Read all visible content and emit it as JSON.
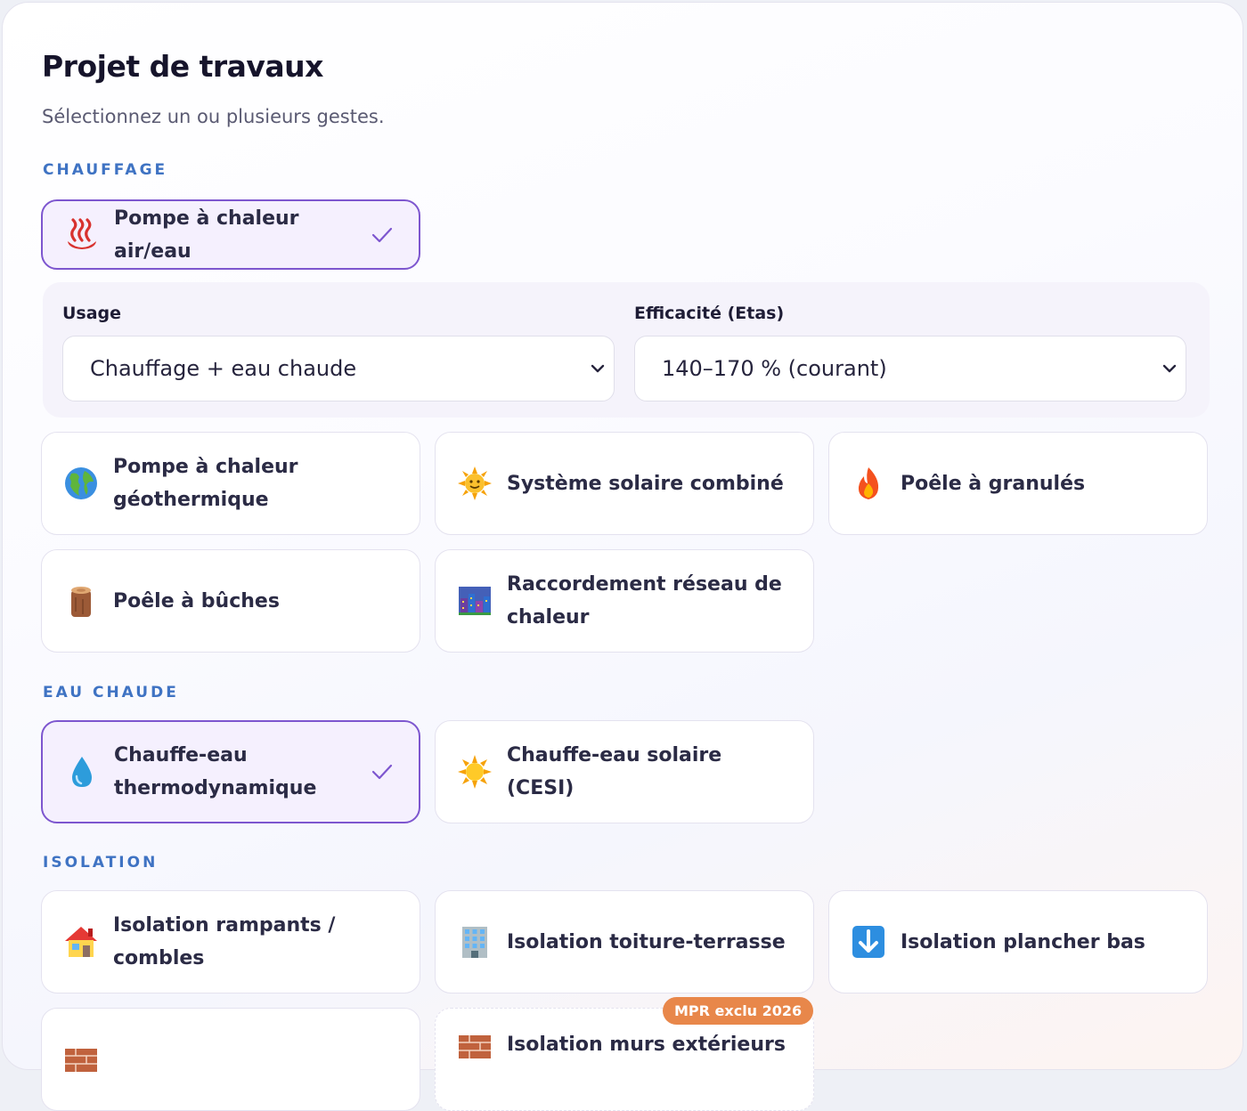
{
  "title": "Projet de travaux",
  "subtitle": "Sélectionnez un ou plusieurs gestes.",
  "accent_color": "#7d56cf",
  "section_color": "#3f73c3",
  "sections": {
    "chauffage": {
      "label": "CHAUFFAGE",
      "selected": {
        "label": "Pompe à chaleur air/eau",
        "icon": "hot-springs-icon",
        "selected": true
      },
      "config": {
        "usage": {
          "label": "Usage",
          "value": "Chauffage + eau chaude"
        },
        "efficacite": {
          "label": "Efficacité (Etas)",
          "value": "140–170 % (courant)"
        }
      },
      "items": [
        {
          "label": "Pompe à chaleur géothermique",
          "icon": "globe-icon"
        },
        {
          "label": "Système solaire combiné",
          "icon": "sun-icon"
        },
        {
          "label": "Poêle à granulés",
          "icon": "fire-icon"
        },
        {
          "label": "Poêle à bûches",
          "icon": "wood-log-icon"
        },
        {
          "label": "Raccordement réseau de chaleur",
          "icon": "city-icon"
        }
      ]
    },
    "eau_chaude": {
      "label": "EAU CHAUDE",
      "items": [
        {
          "label": "Chauffe-eau thermodynamique",
          "icon": "droplet-icon",
          "selected": true
        },
        {
          "label": "Chauffe-eau solaire (CESI)",
          "icon": "sun-icon"
        }
      ]
    },
    "isolation": {
      "label": "ISOLATION",
      "items": [
        {
          "label": "Isolation rampants / combles",
          "icon": "house-icon"
        },
        {
          "label": "Isolation toiture-terrasse",
          "icon": "office-building-icon"
        },
        {
          "label": "Isolation plancher bas",
          "icon": "down-arrow-icon"
        },
        {
          "label": "",
          "icon": "brick-icon"
        },
        {
          "label": "Isolation murs extérieurs",
          "icon": "brick-icon",
          "badge": "MPR exclu 2026"
        }
      ]
    }
  }
}
